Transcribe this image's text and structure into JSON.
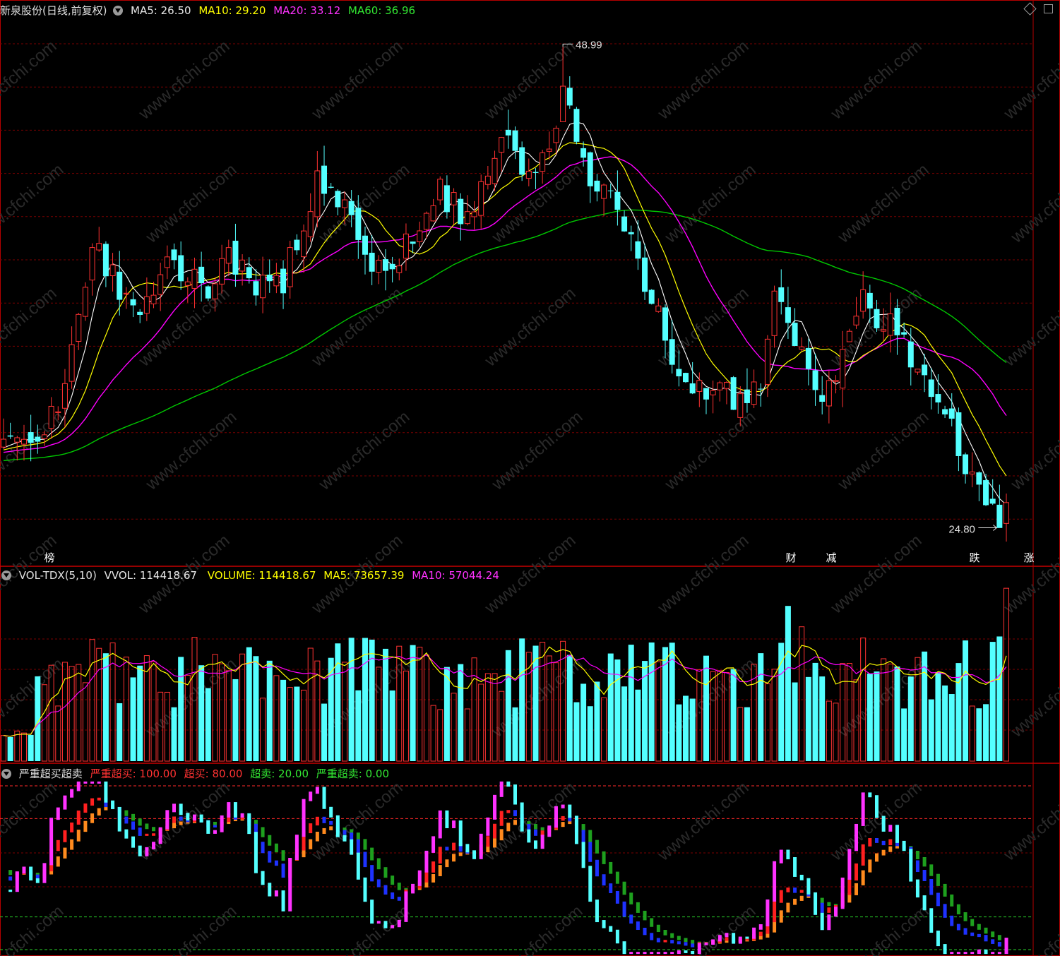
{
  "main_panel": {
    "title": "新泉股份(日线,前复权)",
    "ma5_label": "MA5: 26.50",
    "ma10_label": "MA10: 29.20",
    "ma20_label": "MA20: 33.12",
    "ma60_label": "MA60: 36.96",
    "high_label": "48.99",
    "low_label": "24.80",
    "watermark": "www.cfchi.com",
    "markers": [
      {
        "text": "榜",
        "color": "#c87a2a"
      },
      {
        "text": "财",
        "color": "#2a5aa8"
      },
      {
        "text": "减",
        "color": "#2f8a2f"
      },
      {
        "text": "跌",
        "color": "#2f8a2f"
      },
      {
        "text": "涨",
        "color": "#c62828"
      }
    ]
  },
  "volume_panel": {
    "title": "VOL-TDX(5,10)",
    "vvol_label": "VVOL: 114418.67",
    "volume_label": "VOLUME: 114418.67",
    "ma5_label": "MA5: 73657.39",
    "ma10_label": "MA10: 57044.24"
  },
  "indicator_panel": {
    "title": "严重超买超卖",
    "l1": "严重超买: 100.00",
    "l2": "超买: 80.00",
    "l3": "超卖: 20.00",
    "l4": "严重超卖: 0.00"
  },
  "colors": {
    "up": "#ff3232",
    "down": "#54ffff",
    "ma5": "#ffffff",
    "ma10": "#ffff00",
    "ma20": "#ff00ff",
    "ma60": "#00c800",
    "grid": "#7a0000"
  },
  "chart_data": [
    {
      "type": "candlestick",
      "title": "新泉股份(日线,前复权)",
      "ylim": [
        24,
        50
      ],
      "high_marker": 48.99,
      "low_marker": 24.8,
      "latest_ma": {
        "MA5": 26.5,
        "MA10": 29.2,
        "MA20": 33.12,
        "MA60": 36.96
      },
      "close_path": [
        [
          0,
          29.2
        ],
        [
          6,
          30.0
        ],
        [
          9,
          31.5
        ],
        [
          13,
          39.5
        ],
        [
          17,
          36.8
        ],
        [
          20,
          36.2
        ],
        [
          25,
          38.1
        ],
        [
          30,
          36.8
        ],
        [
          33,
          38.4
        ],
        [
          37,
          37.2
        ],
        [
          41,
          37.0
        ],
        [
          46,
          42.5
        ],
        [
          49,
          40.6
        ],
        [
          51,
          40.7
        ],
        [
          54,
          38.3
        ],
        [
          57,
          38.3
        ],
        [
          61,
          39.6
        ],
        [
          64,
          41.8
        ],
        [
          69,
          39.9
        ],
        [
          71,
          43.0
        ],
        [
          74,
          45.3
        ],
        [
          76,
          43.2
        ],
        [
          78,
          43.3
        ],
        [
          80,
          44.2
        ],
        [
          82,
          46.5
        ],
        [
          83,
          46.0
        ],
        [
          86,
          42.5
        ],
        [
          90,
          40.6
        ],
        [
          94,
          37.4
        ],
        [
          96,
          35.6
        ],
        [
          99,
          32.6
        ],
        [
          101,
          31.2
        ],
        [
          103,
          32.0
        ],
        [
          106,
          31.5
        ],
        [
          109,
          31.2
        ],
        [
          111,
          31.5
        ],
        [
          113,
          36.0
        ],
        [
          116,
          34.7
        ],
        [
          118,
          32.6
        ],
        [
          119,
          31.1
        ],
        [
          121,
          32.1
        ],
        [
          124,
          34.6
        ],
        [
          126,
          36.3
        ],
        [
          128,
          35.4
        ],
        [
          131,
          34.4
        ],
        [
          134,
          33.0
        ],
        [
          137,
          30.6
        ],
        [
          139,
          29.6
        ],
        [
          143,
          26.2
        ],
        [
          146,
          25.0
        ],
        [
          147,
          26.0
        ]
      ]
    },
    {
      "type": "bar",
      "title": "VOL-TDX(5,10)",
      "latest": {
        "VVOL": 114418.67,
        "VOLUME": 114418.67,
        "MA5": 73657.39,
        "MA10": 57044.24
      }
    },
    {
      "type": "line",
      "title": "严重超买超卖",
      "levels": {
        "严重超买": 100.0,
        "超买": 80.0,
        "超卖": 20.0,
        "严重超卖": 0.0
      }
    }
  ]
}
